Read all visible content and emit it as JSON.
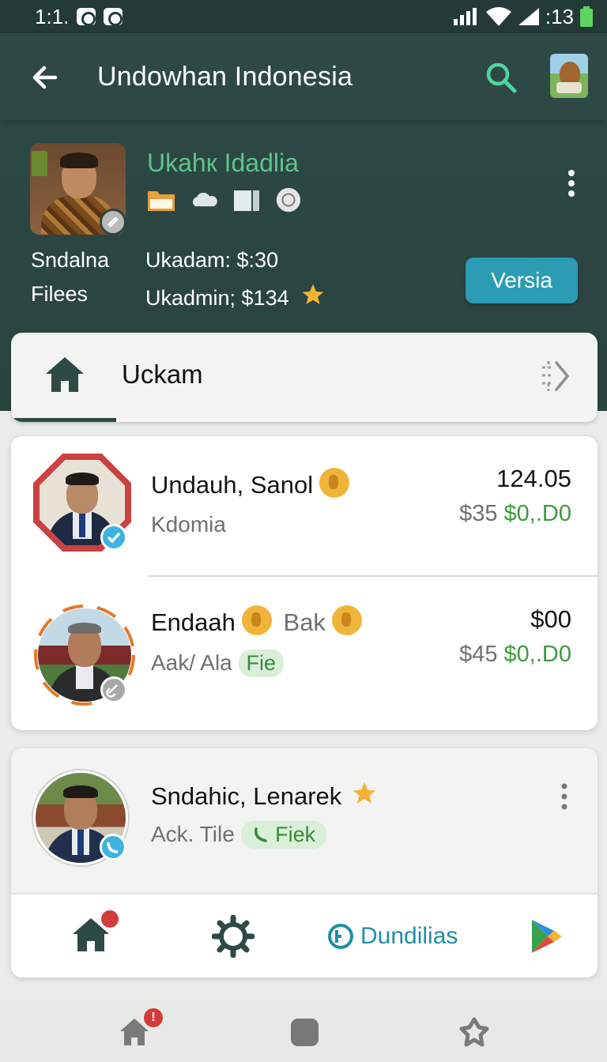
{
  "status_bar": {
    "time": "1:1.",
    "battery_time": ":13"
  },
  "app_bar": {
    "title": "Undowhan Indonesia",
    "back_icon": "arrow-left-icon",
    "search_icon": "search-icon"
  },
  "profile": {
    "name": "Ukahк Idadlia",
    "icons": [
      "folder-icon",
      "cloud-icon",
      "document-icon",
      "sync-icon"
    ],
    "label_line1": "Sndalna",
    "label_line2": "Filees",
    "stat1": "Ukadam: $:30",
    "stat2": "Ukadmin; $134",
    "button_label": "Versia"
  },
  "tab": {
    "label": "Uckam"
  },
  "list": [
    {
      "name": "Undauh, Sanol",
      "subtitle": "Kdomia",
      "amount": "124.05",
      "price_grey": "$35",
      "price_green": "$0,.D0"
    },
    {
      "name": "Endaah",
      "name_extra": "Bak",
      "subtitle": "Aak/ Ala",
      "chip": "Fie",
      "amount": "$00",
      "price_grey": "$45",
      "price_green": "$0,.D0"
    }
  ],
  "card3": {
    "name": "Sndahic, Lenarek",
    "subtitle": "Ack. Tile",
    "chip": "Fiek"
  },
  "bottom_nav": {
    "center_label": "Dundilias"
  },
  "system_nav": {
    "badge": "!"
  },
  "colors": {
    "header": "#2e4945",
    "accent_green": "#5ec48c",
    "button_blue": "#2b9cb4",
    "price_green": "#3d9a3b"
  }
}
